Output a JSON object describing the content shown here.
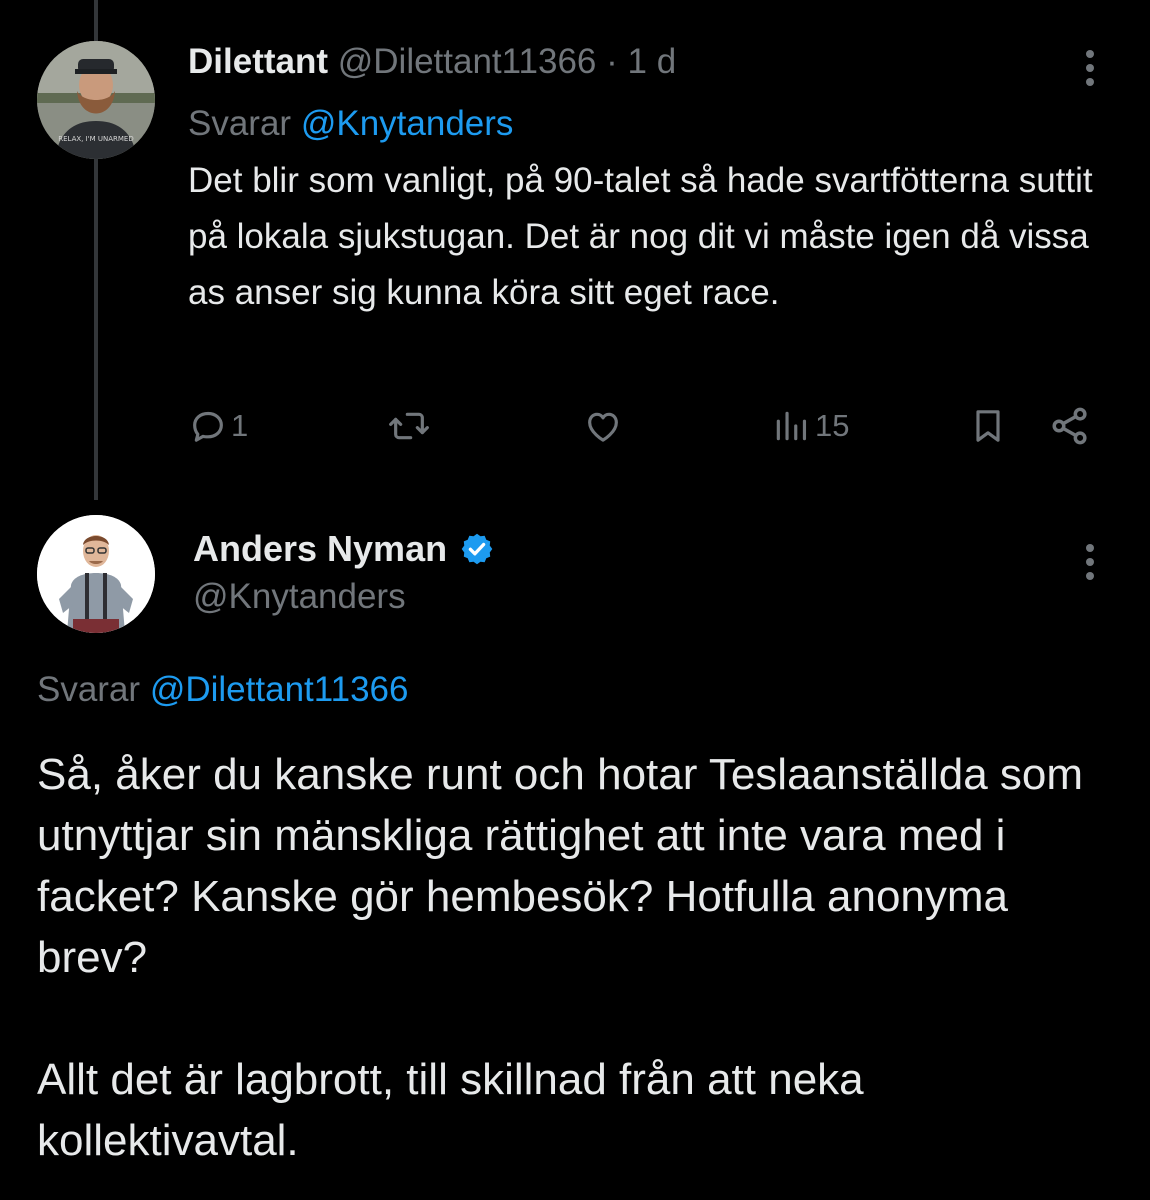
{
  "tweet1": {
    "display_name": "Dilettant",
    "handle": "@Dilettant11366",
    "separator": "·",
    "time": "1 d",
    "replying_prefix": "Svarar",
    "replying_to": "@Knytanders",
    "text": "Det blir som vanligt, på 90-talet så hade svartfötterna suttit på lokala sjukstugan. Det är nog dit vi måste igen då vissa as anser sig kunna köra sitt eget race.",
    "actions": {
      "reply_count": "1",
      "views_count": "15"
    },
    "avatar_shirt_text": "RELAX, I'M UNARMED"
  },
  "tweet2": {
    "display_name": "Anders Nyman",
    "handle": "@Knytanders",
    "verified": true,
    "replying_prefix": "Svarar",
    "replying_to": "@Dilettant11366",
    "text_paragraph_1": "Så, åker du kanske runt och hotar Teslaanställda som utnyttjar sin mänskliga rättighet att inte vara med i facket? Kanske gör hembesök? Hotfulla anonyma brev?",
    "text_paragraph_2": "Allt det är lagbrott, till skillnad från att neka kollektivavtal."
  },
  "icons": [
    "more-icon",
    "reply-icon",
    "retweet-icon",
    "like-icon",
    "views-icon",
    "bookmark-icon",
    "share-icon",
    "verified-badge-icon"
  ],
  "colors": {
    "background": "#000000",
    "text": "#e7e9ea",
    "muted": "#71767b",
    "link": "#1d9bf0",
    "thread_line": "#333639"
  }
}
